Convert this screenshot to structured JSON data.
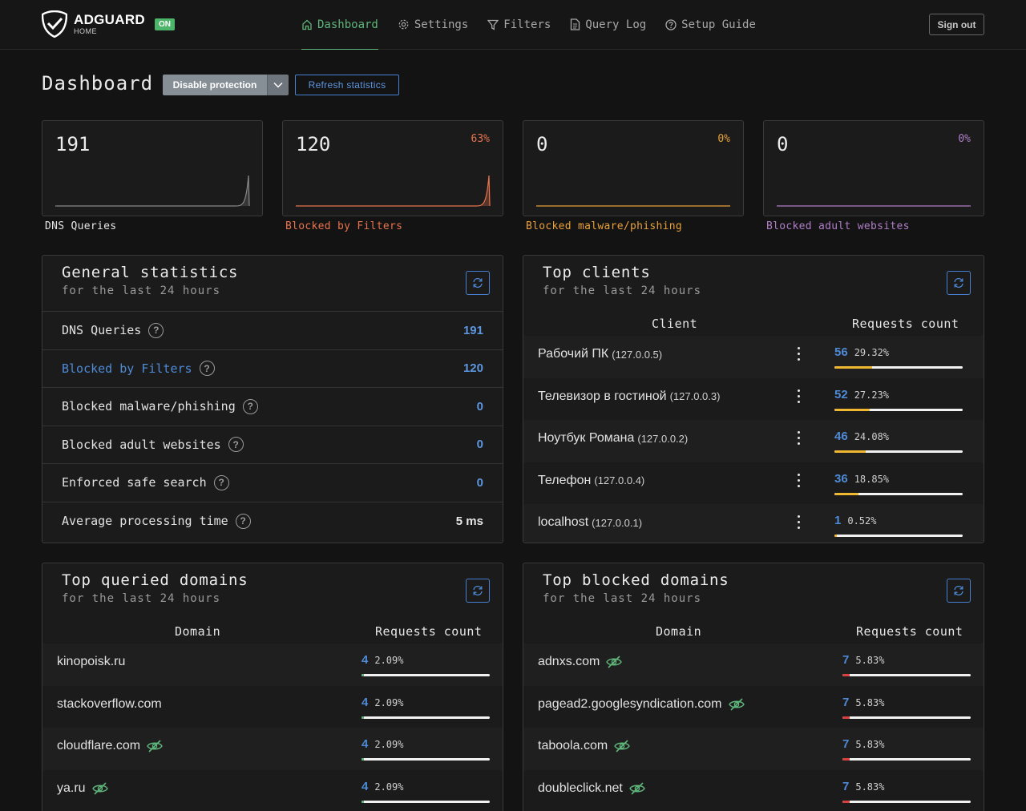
{
  "header": {
    "logo_title": "ADGUARD",
    "logo_sub": "HOME",
    "status_badge": "ON",
    "nav": [
      {
        "label": "Dashboard",
        "icon": "home-icon",
        "active": true
      },
      {
        "label": "Settings",
        "icon": "gear-icon"
      },
      {
        "label": "Filters",
        "icon": "filter-icon"
      },
      {
        "label": "Query Log",
        "icon": "document-icon"
      },
      {
        "label": "Setup Guide",
        "icon": "help-circle-icon"
      }
    ],
    "signout_label": "Sign out"
  },
  "page": {
    "title": "Dashboard",
    "disable_label": "Disable protection",
    "refresh_label": "Refresh statistics"
  },
  "stat_cards": [
    {
      "value": "191",
      "percent": "",
      "label": "DNS Queries",
      "color": "#e6e6e6",
      "line": "#888888"
    },
    {
      "value": "120",
      "percent": "63%",
      "label": "Blocked by Filters",
      "color": "#e8744d",
      "line": "#e8744d"
    },
    {
      "value": "0",
      "percent": "0%",
      "label": "Blocked malware/phishing",
      "color": "#e8a03a",
      "line": "#e8a03a"
    },
    {
      "value": "0",
      "percent": "0%",
      "label": "Blocked adult websites",
      "color": "#b07ec7",
      "line": "#b07ec7"
    }
  ],
  "general": {
    "title": "General statistics",
    "subtitle": "for the last 24 hours",
    "rows": [
      {
        "label": "DNS Queries",
        "value": "191"
      },
      {
        "label": "Blocked by Filters",
        "value": "120"
      },
      {
        "label": "Blocked malware/phishing",
        "value": "0"
      },
      {
        "label": "Blocked adult websites",
        "value": "0"
      },
      {
        "label": "Enforced safe search",
        "value": "0"
      },
      {
        "label": "Average processing time",
        "value": "5 ms"
      }
    ]
  },
  "clients": {
    "title": "Top clients",
    "subtitle": "for the last 24 hours",
    "col_client": "Client",
    "col_count": "Requests count",
    "rows": [
      {
        "name": "Рабочий ПК",
        "ip": "(127.0.0.5)",
        "count": "56",
        "percent": "29.32%",
        "fraction": 0.2932
      },
      {
        "name": "Телевизор в гостиной",
        "ip": "(127.0.0.3)",
        "count": "52",
        "percent": "27.23%",
        "fraction": 0.2723
      },
      {
        "name": "Ноутбук Романа",
        "ip": "(127.0.0.2)",
        "count": "46",
        "percent": "24.08%",
        "fraction": 0.2408
      },
      {
        "name": "Телефон",
        "ip": "(127.0.0.4)",
        "count": "36",
        "percent": "18.85%",
        "fraction": 0.1885
      },
      {
        "name": "localhost",
        "ip": "(127.0.0.1)",
        "count": "1",
        "percent": "0.52%",
        "fraction": 0.0052
      }
    ]
  },
  "queried": {
    "title": "Top queried domains",
    "subtitle": "for the last 24 hours",
    "col_domain": "Domain",
    "col_count": "Requests count",
    "rows": [
      {
        "domain": "kinopoisk.ru",
        "tracker": false,
        "count": "4",
        "percent": "2.09%",
        "fraction": 0.0209
      },
      {
        "domain": "stackoverflow.com",
        "tracker": false,
        "count": "4",
        "percent": "2.09%",
        "fraction": 0.0209
      },
      {
        "domain": "cloudflare.com",
        "tracker": true,
        "count": "4",
        "percent": "2.09%",
        "fraction": 0.0209
      },
      {
        "domain": "ya.ru",
        "tracker": true,
        "count": "4",
        "percent": "2.09%",
        "fraction": 0.0209
      }
    ]
  },
  "blocked": {
    "title": "Top blocked domains",
    "subtitle": "for the last 24 hours",
    "col_domain": "Domain",
    "col_count": "Requests count",
    "rows": [
      {
        "domain": "adnxs.com",
        "tracker": true,
        "count": "7",
        "percent": "5.83%",
        "fraction": 0.0583
      },
      {
        "domain": "pagead2.googlesyndication.com",
        "tracker": true,
        "count": "7",
        "percent": "5.83%",
        "fraction": 0.0583
      },
      {
        "domain": "taboola.com",
        "tracker": true,
        "count": "7",
        "percent": "5.83%",
        "fraction": 0.0583
      },
      {
        "domain": "doubleclick.net",
        "tracker": true,
        "count": "7",
        "percent": "5.83%",
        "fraction": 0.0583
      }
    ]
  },
  "colors": {
    "accent_green": "#5fb57a",
    "accent_blue": "#4e8ad6",
    "client_bar": "#f0b731",
    "queried_bar": "#5fb57a",
    "blocked_bar": "#d94141"
  }
}
